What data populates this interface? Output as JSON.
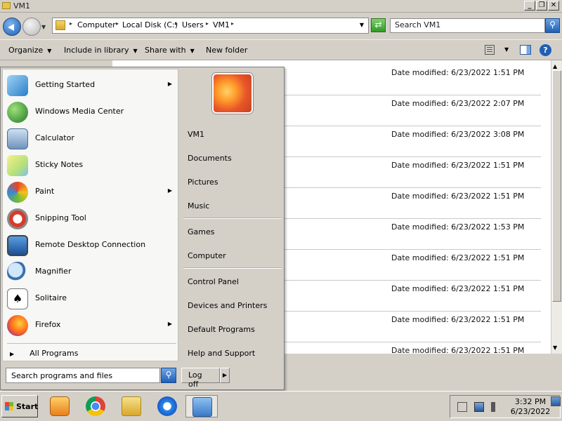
{
  "window": {
    "title": "VM1"
  },
  "address": {
    "crumbs": [
      "Computer",
      "Local Disk (C:)",
      "Users",
      "VM1"
    ]
  },
  "search": {
    "value": "Search VM1"
  },
  "toolbar": {
    "organize": "Organize",
    "include": "Include in library",
    "share": "Share with",
    "new_folder": "New folder"
  },
  "files": {
    "dates": [
      "Date modified: 6/23/2022 1:51 PM",
      "Date modified: 6/23/2022 2:07 PM",
      "Date modified: 6/23/2022 3:08 PM",
      "Date modified: 6/23/2022 1:51 PM",
      "Date modified: 6/23/2022 1:51 PM",
      "Date modified: 6/23/2022 1:53 PM",
      "Date modified: 6/23/2022 1:51 PM",
      "Date modified: 6/23/2022 1:51 PM",
      "Date modified: 6/23/2022 1:51 PM",
      "Date modified: 6/23/2022 1:51 PM"
    ]
  },
  "startmenu": {
    "programs": [
      {
        "label": "Getting Started",
        "icon": "getting-started-icon",
        "submenu": true
      },
      {
        "label": "Windows Media Center",
        "icon": "media-center-icon",
        "submenu": false
      },
      {
        "label": "Calculator",
        "icon": "calculator-icon",
        "submenu": false
      },
      {
        "label": "Sticky Notes",
        "icon": "sticky-notes-icon",
        "submenu": false
      },
      {
        "label": "Paint",
        "icon": "paint-icon",
        "submenu": true
      },
      {
        "label": "Snipping Tool",
        "icon": "snipping-tool-icon",
        "submenu": false
      },
      {
        "label": "Remote Desktop Connection",
        "icon": "remote-desktop-icon",
        "submenu": false
      },
      {
        "label": "Magnifier",
        "icon": "magnifier-icon",
        "submenu": false
      },
      {
        "label": "Solitaire",
        "icon": "solitaire-icon",
        "submenu": false
      },
      {
        "label": "Firefox",
        "icon": "firefox-icon",
        "submenu": true
      }
    ],
    "all_programs": "All Programs",
    "right": [
      "VM1",
      "Documents",
      "Pictures",
      "Music",
      "Games",
      "Computer",
      "Control Panel",
      "Devices and Printers",
      "Default Programs",
      "Help and Support"
    ],
    "search_placeholder": "Search programs and files",
    "log_off": "Log off"
  },
  "taskbar": {
    "start": "Start",
    "pinned": [
      "media-player-icon",
      "chrome-icon",
      "explorer-icon",
      "internet-explorer-icon",
      "control-panel-icon"
    ],
    "time": "3:32 PM",
    "date": "6/23/2022"
  },
  "colors": {
    "accent": "#1e5fb8",
    "chrome": "#d4d0c8"
  }
}
